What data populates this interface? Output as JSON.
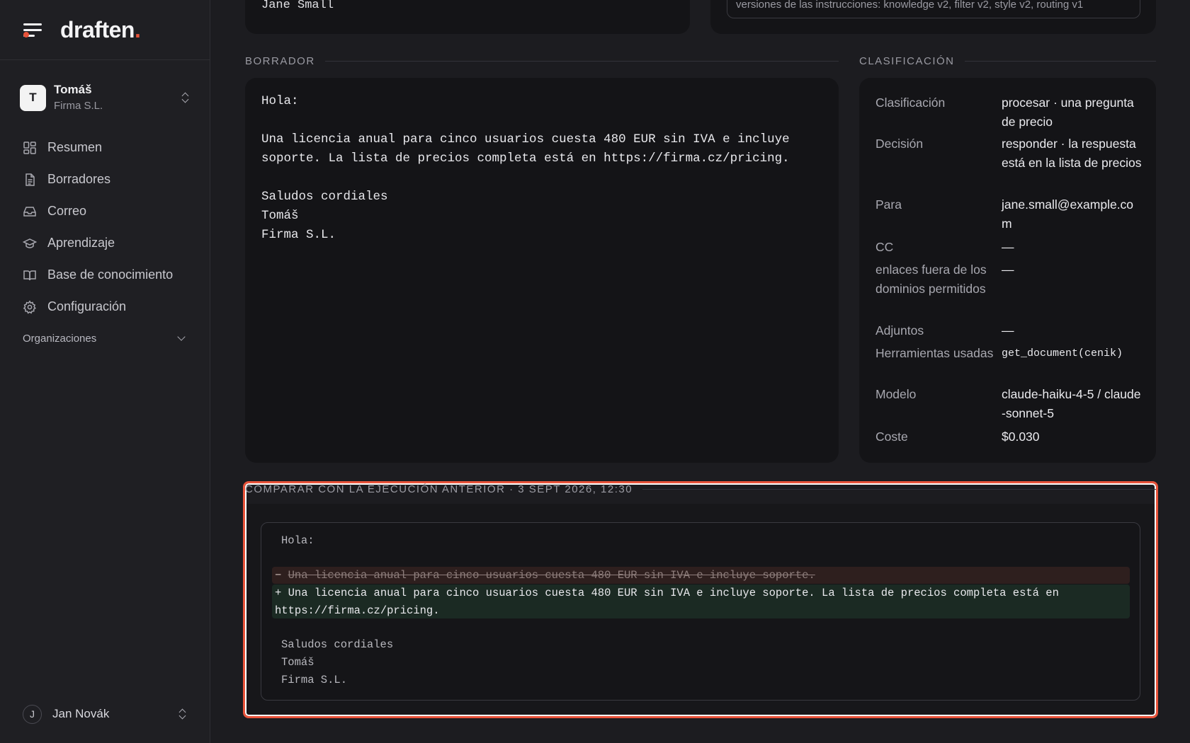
{
  "brand": {
    "name": "draften",
    "accent": "."
  },
  "org": {
    "initial": "T",
    "name": "Tomáš",
    "company": "Firma S.L."
  },
  "nav": {
    "items": [
      {
        "label": "Resumen",
        "icon": "dashboard-icon"
      },
      {
        "label": "Borradores",
        "icon": "document-icon"
      },
      {
        "label": "Correo",
        "icon": "inbox-icon"
      },
      {
        "label": "Aprendizaje",
        "icon": "graduation-cap-icon"
      },
      {
        "label": "Base de conocimiento",
        "icon": "book-icon"
      },
      {
        "label": "Configuración",
        "icon": "gear-icon"
      }
    ],
    "group_label": "Organizaciones"
  },
  "user": {
    "initial": "J",
    "name": "Jan Novák"
  },
  "top_cards": {
    "signature_tail": "Jane Small",
    "versions_text": "versiones de las instrucciones: knowledge v2, filter v2, style v2, routing v1"
  },
  "draft": {
    "section_title": "Borrador",
    "body": "Hola:\n\nUna licencia anual para cinco usuarios cuesta 480 EUR sin IVA e incluye\nsoporte. La lista de precios completa está en https://firma.cz/pricing.\n\nSaludos cordiales\nTomáš\nFirma S.L."
  },
  "classification": {
    "section_title": "Clasificación",
    "rows": [
      {
        "key": "Clasificación",
        "value": "procesar · una pregunta de precio"
      },
      {
        "key": "Decisión",
        "value": "responder · la respuesta está en la lista de precios"
      },
      {
        "key": "Para",
        "value": "jane.small@example.com"
      },
      {
        "key": "CC",
        "value": "—"
      },
      {
        "key": "enlaces fuera de los dominios permitidos",
        "value": "—"
      },
      {
        "key": "Adjuntos",
        "value": "—"
      },
      {
        "key": "Herramientas usadas",
        "value": "get_document(cenik)"
      },
      {
        "key": "Modelo",
        "value": "claude-haiku-4-5 / claude-sonnet-5"
      },
      {
        "key": "Coste",
        "value": "$0.030"
      }
    ]
  },
  "compare": {
    "section_title": "Comparar con la ejecución anterior · 3 sept 2026, 12:30",
    "context_top": "Hola:",
    "removed_sign": "−",
    "removed": "Una licencia anual para cinco usuarios cuesta 480 EUR sin IVA e incluye soporte.",
    "added": "+ Una licencia anual para cinco usuarios cuesta 480 EUR sin IVA e incluye soporte. La lista de precios completa está en\nhttps://firma.cz/pricing.",
    "context_bottom": [
      "Saludos cordiales",
      "Tomáš",
      "Firma S.L."
    ]
  },
  "colors": {
    "accent": "#e8533a",
    "background": "#1c1c20",
    "card": "#141417",
    "diff_removed_bg": "#2e1f1e",
    "diff_added_bg": "#1b2a23"
  }
}
